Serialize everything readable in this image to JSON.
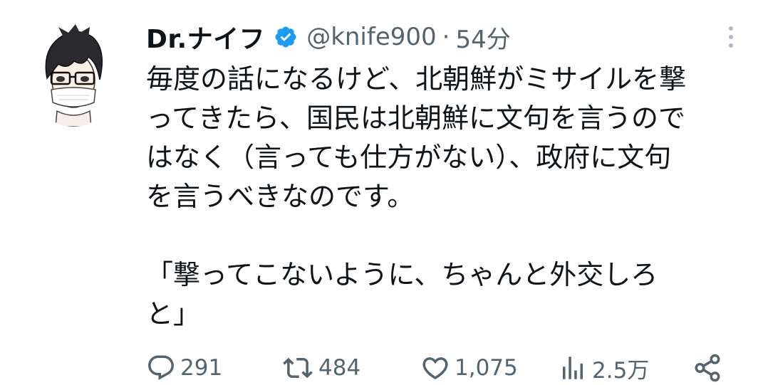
{
  "tweet": {
    "author": {
      "display_name": "Dr.ナイフ",
      "handle": "@knife900",
      "verified": true,
      "avatar_icon": "avatar-illustration-icon"
    },
    "separator": "·",
    "time": "54分",
    "text_lines": [
      "毎度の話になるけど、北朝鮮がミサイルを撃",
      "ってきたら、国民は北朝鮮に文句を言うので",
      "はなく（言っても仕方がない）、政府に文句",
      "を言うべきなのです。",
      "",
      "「撃ってこないように、ちゃんと外交しろ",
      "と」"
    ],
    "actions": {
      "reply": {
        "icon": "reply-icon",
        "count": "291"
      },
      "retweet": {
        "icon": "retweet-icon",
        "count": "484"
      },
      "like": {
        "icon": "heart-icon",
        "count": "1,075"
      },
      "views": {
        "icon": "views-chart-icon",
        "count": "2.5万"
      },
      "share": {
        "icon": "share-icon"
      }
    },
    "colors": {
      "text": "#0f1419",
      "secondary": "#536471",
      "verified_badge": "#1d9bf0"
    }
  }
}
